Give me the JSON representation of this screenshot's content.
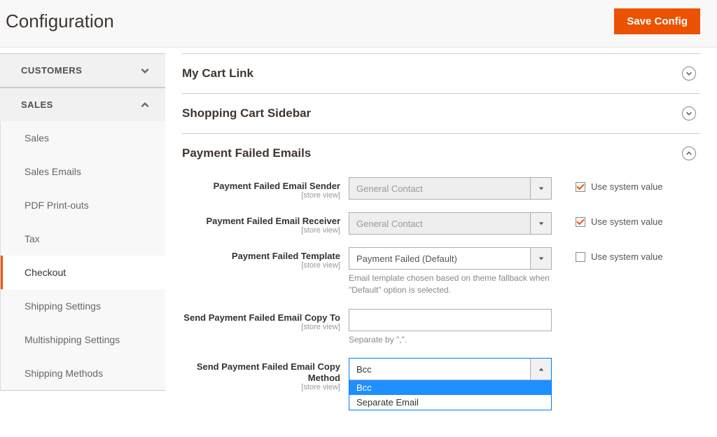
{
  "header": {
    "title": "Configuration",
    "save_button": "Save Config"
  },
  "sidebar": {
    "groups": [
      {
        "label": "CUSTOMERS",
        "expanded": false,
        "items": []
      },
      {
        "label": "SALES",
        "expanded": true,
        "items": [
          {
            "label": "Sales",
            "active": false
          },
          {
            "label": "Sales Emails",
            "active": false
          },
          {
            "label": "PDF Print-outs",
            "active": false
          },
          {
            "label": "Tax",
            "active": false
          },
          {
            "label": "Checkout",
            "active": true
          },
          {
            "label": "Shipping Settings",
            "active": false
          },
          {
            "label": "Multishipping Settings",
            "active": false
          },
          {
            "label": "Shipping Methods",
            "active": false
          }
        ]
      }
    ]
  },
  "sections": {
    "my_cart_link": {
      "title": "My Cart Link",
      "expanded": false
    },
    "cart_sidebar": {
      "title": "Shopping Cart Sidebar",
      "expanded": false
    },
    "payment_failed": {
      "title": "Payment Failed Emails",
      "expanded": true,
      "fields": {
        "sender": {
          "label": "Payment Failed Email Sender",
          "scope": "[store view]",
          "value": "General Contact",
          "use_system": true
        },
        "receiver": {
          "label": "Payment Failed Email Receiver",
          "scope": "[store view]",
          "value": "General Contact",
          "use_system": true
        },
        "template": {
          "label": "Payment Failed Template",
          "scope": "[store view]",
          "value": "Payment Failed (Default)",
          "use_system": false,
          "helper": "Email template chosen based on theme fallback when \"Default\" option is selected."
        },
        "copy_to": {
          "label": "Send Payment Failed Email Copy To",
          "scope": "[store view]",
          "value": "",
          "helper": "Separate by \",\"."
        },
        "copy_method": {
          "label": "Send Payment Failed Email Copy Method",
          "scope": "[store view]",
          "value": "Bcc",
          "options": [
            "Bcc",
            "Separate Email"
          ],
          "highlighted": "Bcc"
        }
      }
    }
  },
  "labels": {
    "use_system": "Use system value"
  }
}
